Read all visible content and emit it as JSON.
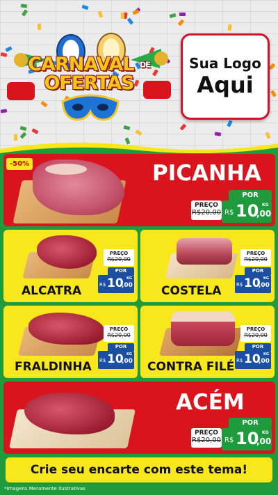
{
  "header": {
    "banner_line1": "CARNAVAL",
    "banner_de": "DE",
    "banner_line2": "OFERTAS",
    "logo_line1": "Sua Logo",
    "logo_line2": "Aqui"
  },
  "colors": {
    "red": "#d9141d",
    "yellow": "#f8e71c",
    "green": "#1f9a3c",
    "blue": "#1b4fa3"
  },
  "products": {
    "picanha": {
      "name": "PICANHA",
      "badge": "-50%",
      "preco_label": "PREÇO",
      "old_price": "R$20,00",
      "por_label": "POR",
      "currency": "R$",
      "price_int": "10",
      "price_dec": ",00",
      "unit": "KG"
    },
    "alcatra": {
      "name": "ALCATRA",
      "preco_label": "PREÇO",
      "old_price": "R$20,00",
      "por_label": "POR",
      "currency": "R$",
      "price_int": "10",
      "price_dec": ",00",
      "unit": "KG"
    },
    "costela": {
      "name": "COSTELA",
      "preco_label": "PREÇO",
      "old_price": "R$20,00",
      "por_label": "POR",
      "currency": "R$",
      "price_int": "10",
      "price_dec": ",00",
      "unit": "KG"
    },
    "fraldinha": {
      "name": "FRALDINHA",
      "preco_label": "PREÇO",
      "old_price": "R$20,00",
      "por_label": "POR",
      "currency": "R$",
      "price_int": "10",
      "price_dec": ",00",
      "unit": "KG"
    },
    "contrafile": {
      "name": "CONTRA FILÉ",
      "preco_label": "PREÇO",
      "old_price": "R$20,00",
      "por_label": "POR",
      "currency": "R$",
      "price_int": "10",
      "price_dec": ",00",
      "unit": "KG"
    },
    "acem": {
      "name": "ACÉM",
      "preco_label": "PREÇO",
      "old_price": "R$20,00",
      "por_label": "POR",
      "currency": "R$",
      "price_int": "10",
      "price_dec": ",00",
      "unit": "KG"
    }
  },
  "footer": {
    "cta": "Crie seu encarte com este tema!",
    "disclaimer": "*Imagens Meramente Ilustrativas"
  }
}
